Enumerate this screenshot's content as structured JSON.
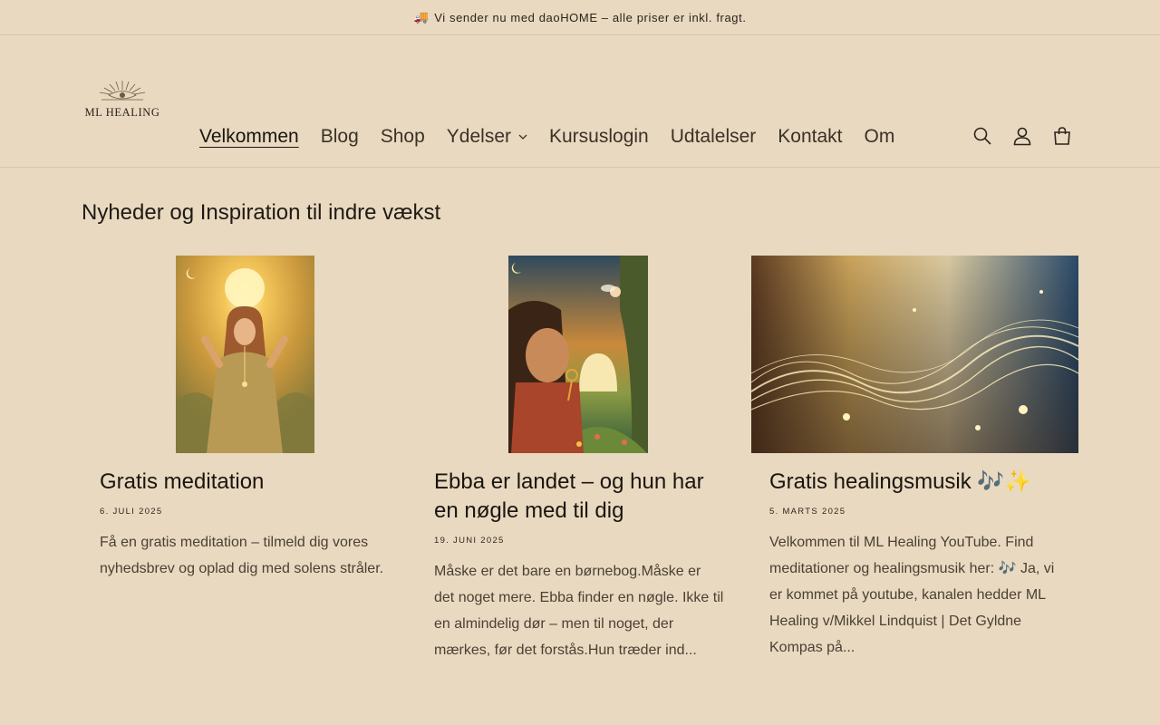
{
  "announcement": {
    "icon": "truck-icon",
    "text": "Vi sender nu med daoHOME – alle priser er inkl. fragt."
  },
  "logo": {
    "text": "ML HEALING"
  },
  "nav": {
    "items": [
      {
        "label": "Velkommen",
        "active": true
      },
      {
        "label": "Blog"
      },
      {
        "label": "Shop"
      },
      {
        "label": "Ydelser",
        "dropdown": true
      },
      {
        "label": "Kursuslogin"
      },
      {
        "label": "Udtalelser"
      },
      {
        "label": "Kontakt"
      },
      {
        "label": "Om"
      }
    ]
  },
  "header_icons": [
    "search-icon",
    "account-icon",
    "cart-icon"
  ],
  "page": {
    "title": "Nyheder og Inspiration til indre vækst"
  },
  "articles": [
    {
      "title": "Gratis meditation",
      "date": "6. JULI 2025",
      "excerpt": "Få en gratis meditation – tilmeld dig vores nyhedsbrev og oplad dig med solens stråler."
    },
    {
      "title": "Ebba er landet – og hun har en nøgle med til dig",
      "date": "19. JUNI 2025",
      "excerpt": "Måske er det bare en børnebog.Måske er det noget mere. Ebba finder en nøgle. Ikke til en almindelig dør – men til noget, der mærkes, før det forstås.Hun træder ind..."
    },
    {
      "title": "Gratis healingsmusik 🎶✨",
      "date": "5. MARTS 2025",
      "excerpt": "Velkommen til ML Healing YouTube. Find meditationer og healingsmusik her:  🎶 Ja, vi er kommet på youtube, kanalen hedder ML Healing v/Mikkel Lindquist | Det Gyldne Kompas på..."
    }
  ],
  "colors": {
    "background": "#e9d9c0",
    "text": "#1f1a14",
    "border": "#d6c4a8"
  }
}
